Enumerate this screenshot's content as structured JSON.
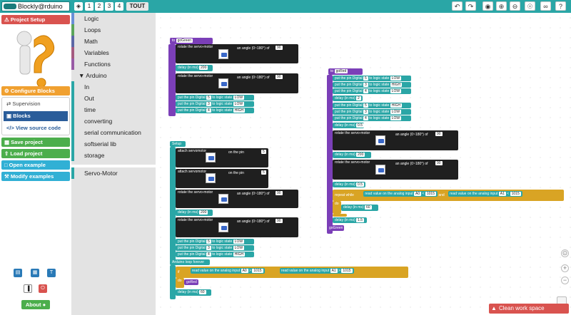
{
  "app": {
    "title": "Blockly@rduino"
  },
  "levels": [
    "1",
    "2",
    "3",
    "4",
    "TOUT"
  ],
  "toolbar_icons": [
    "undo-icon",
    "redo-icon",
    "camera-icon",
    "zoom-in-icon",
    "zoom-out-icon",
    "eye-icon",
    "link-icon",
    "help-icon"
  ],
  "left_panel": {
    "project_setup": "Project Setup",
    "configure_blocks": "Configure Blocks",
    "tabs": [
      "Supervision",
      "Blocks",
      "View source code"
    ],
    "save_project": "Save project",
    "load_project": "Load project",
    "open_example": "Open example",
    "modify_examples": "Modify examples",
    "about": "About"
  },
  "toolbox": {
    "categories": [
      {
        "label": "Logic",
        "color": "#6a8fd8"
      },
      {
        "label": "Loops",
        "color": "#5ba55b"
      },
      {
        "label": "Math",
        "color": "#5c68a6"
      },
      {
        "label": "Variables",
        "color": "#a55b80"
      },
      {
        "label": "Functions",
        "color": "#995ba5"
      },
      {
        "label": "▼ Arduino",
        "color": ""
      },
      {
        "label": "In",
        "color": "#2aa6a6"
      },
      {
        "label": "Out",
        "color": "#2aa6a6"
      },
      {
        "label": "time",
        "color": "#2aa6a6"
      },
      {
        "label": "converting",
        "color": "#2aa6a6"
      },
      {
        "label": "serial communication",
        "color": "#2aa6a6"
      },
      {
        "label": "softserial lib",
        "color": "#2aa6a6"
      },
      {
        "label": "storage",
        "color": "#2aa6a6"
      },
      {
        "label": "Servo-Motor",
        "color": "#2aa6a6"
      }
    ]
  },
  "blocks": {
    "to": "to",
    "proc_green": "goGreen",
    "proc_red": "goRed",
    "rotate": "rotate the servo-motor",
    "angle_text": "an angle (0~180°) of",
    "delay": "delay (in ms)",
    "put_pin": "put the pin Digital",
    "logic_state": "to logic state",
    "low": "LOW",
    "high": "HIGH",
    "setup": "Setup",
    "attach": "attach servomotor",
    "on_pin": "on the pin",
    "loop": "Arduino loop forever",
    "read_analog": "read value on the analog input",
    "repeat_while": "repeat while",
    "do": "do",
    "if": "if",
    "and": "and",
    "lt": "<",
    "gt": ">",
    "pin_a0": "A0",
    "pin_a1": "A1",
    "val_90": "90",
    "val_200": "200",
    "val_60": "60",
    "val_05": "0.5",
    "val_15": "1.5",
    "val_2": "2",
    "val_1015": "1015",
    "val_5": "5",
    "val_3": "3",
    "val_4": "4"
  },
  "clean_button": "Clean work space"
}
